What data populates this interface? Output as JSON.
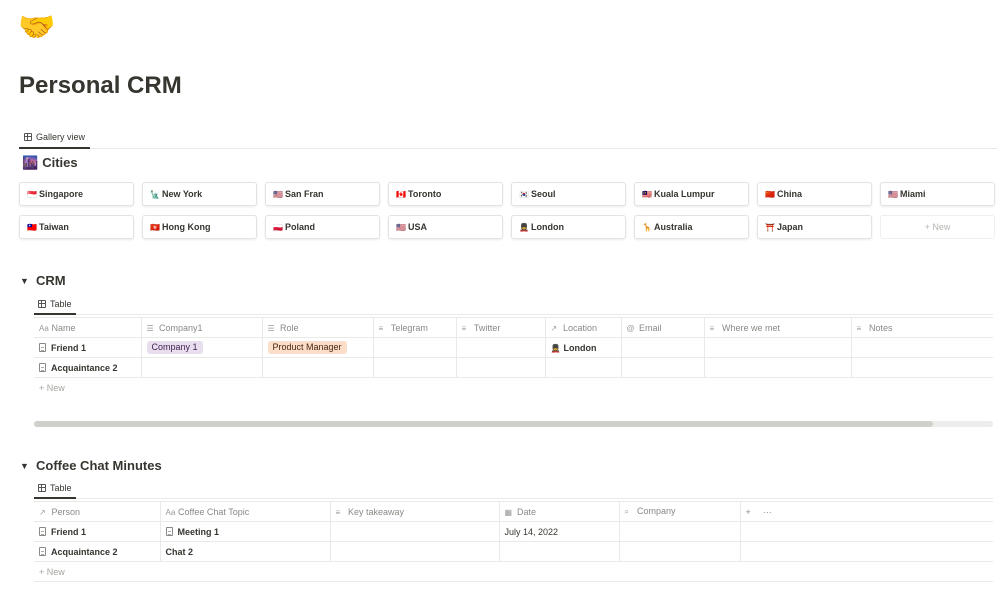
{
  "page": {
    "icon": "🤝",
    "title": "Personal CRM"
  },
  "gallery": {
    "tab_label": "Gallery view",
    "section_icon": "🌆",
    "section_title": "Cities",
    "new_label": "+ New",
    "cities": [
      {
        "flag": "🇸🇬",
        "name": "Singapore"
      },
      {
        "flag": "🗽",
        "name": "New York"
      },
      {
        "flag": "🇺🇸",
        "name": "San Fran"
      },
      {
        "flag": "🇨🇦",
        "name": "Toronto"
      },
      {
        "flag": "🇰🇷",
        "name": "Seoul"
      },
      {
        "flag": "🇲🇾",
        "name": "Kuala Lumpur"
      },
      {
        "flag": "🇨🇳",
        "name": "China"
      },
      {
        "flag": "🇺🇸",
        "name": "Miami"
      },
      {
        "flag": "🇹🇼",
        "name": "Taiwan"
      },
      {
        "flag": "🇭🇰",
        "name": "Hong Kong"
      },
      {
        "flag": "🇵🇱",
        "name": "Poland"
      },
      {
        "flag": "🇺🇸",
        "name": "USA"
      },
      {
        "flag": "💂",
        "name": "London"
      },
      {
        "flag": "🦒",
        "name": "Australia"
      },
      {
        "flag": "⛩️",
        "name": "Japan"
      }
    ]
  },
  "crm": {
    "toggle": "▼",
    "title": "CRM",
    "tab_label": "Table",
    "columns": [
      {
        "icon": "Aa",
        "label": "Name"
      },
      {
        "icon": "☰",
        "label": "Company1"
      },
      {
        "icon": "☰",
        "label": "Role"
      },
      {
        "icon": "≡",
        "label": "Telegram"
      },
      {
        "icon": "≡",
        "label": "Twitter"
      },
      {
        "icon": "↗",
        "label": "Location"
      },
      {
        "icon": "@",
        "label": "Email"
      },
      {
        "icon": "≡",
        "label": "Where we met"
      },
      {
        "icon": "≡",
        "label": "Notes"
      }
    ],
    "rows": [
      {
        "name": "Friend 1",
        "company": "Company 1",
        "role": "Product Manager",
        "location_icon": "💂",
        "location": "London"
      },
      {
        "name": "Acquaintance 2",
        "company": "",
        "role": "",
        "location_icon": "",
        "location": ""
      }
    ],
    "new_label": "+ New",
    "scroll_fraction": 0.937
  },
  "coffee": {
    "toggle": "▼",
    "title": "Coffee Chat Minutes",
    "tab_label": "Table",
    "columns": [
      {
        "icon": "↗",
        "label": "Person"
      },
      {
        "icon": "Aa",
        "label": "Coffee Chat Topic"
      },
      {
        "icon": "≡",
        "label": "Key takeaway"
      },
      {
        "icon": "▦",
        "label": "Date"
      },
      {
        "icon": "⌕",
        "label": "Company"
      }
    ],
    "add_column": "+",
    "more": "···",
    "rows": [
      {
        "person": "Friend 1",
        "topic": "Meeting 1",
        "takeaway": "",
        "date": "July 14, 2022",
        "company": ""
      },
      {
        "person": "Acquaintance 2",
        "topic": "Chat 2",
        "takeaway": "",
        "date": "",
        "company": ""
      }
    ],
    "new_label": "+ New"
  },
  "colors": {
    "text": "#37352f",
    "muted": "#9b9a97",
    "tag_company_bg": "#e8deee",
    "tag_company_fg": "#412454",
    "tag_role_bg": "#fadec9",
    "tag_role_fg": "#49290e"
  }
}
